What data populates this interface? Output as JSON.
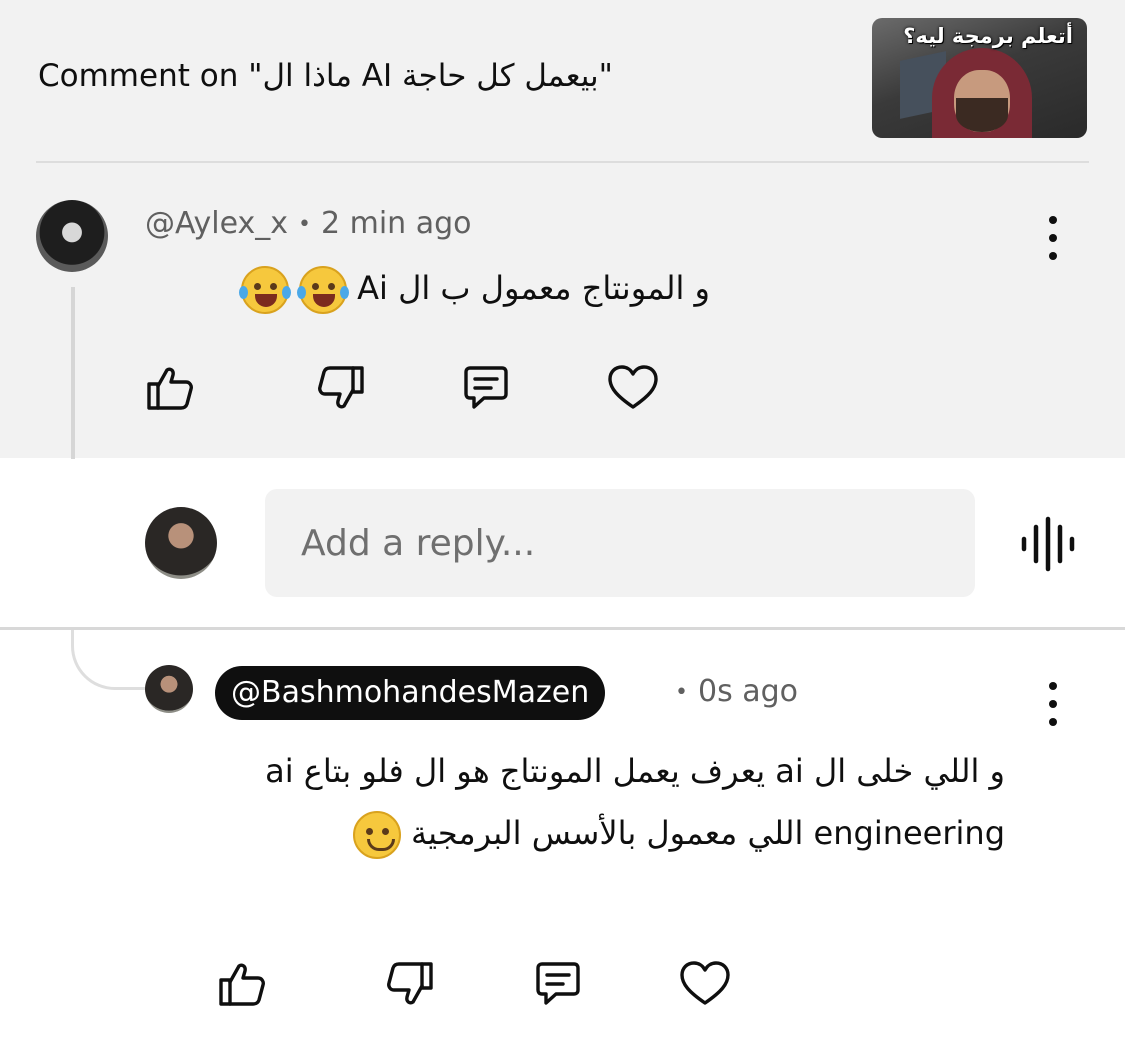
{
  "video": {
    "comment_on_label": "Comment on \"ماذا ال AI بيعمل كل حاجة\"",
    "thumbnail_text": "أتعلم برمجة ليه؟"
  },
  "comments": [
    {
      "handle": "@Aylex_x",
      "time": "2 min ago",
      "text": "و المونتاج معمول ب ال Ai",
      "emoji": [
        "face-with-tears-of-joy",
        "face-with-tears-of-joy"
      ]
    }
  ],
  "reply_box": {
    "placeholder": "Add a reply...",
    "voice_icon": "voice-waveform-icon"
  },
  "reply": {
    "handle": "@BashmohandesMazen",
    "time": "0s ago",
    "text": "و اللي خلى ال ai يعرف يعمل المونتاج هو ال  فلو بتاع ai engineering اللي معمول بالأسس البرمجية",
    "emoji": "slightly-smiling-face"
  },
  "actions": [
    "like-icon",
    "dislike-icon",
    "reply-icon",
    "heart-icon"
  ]
}
